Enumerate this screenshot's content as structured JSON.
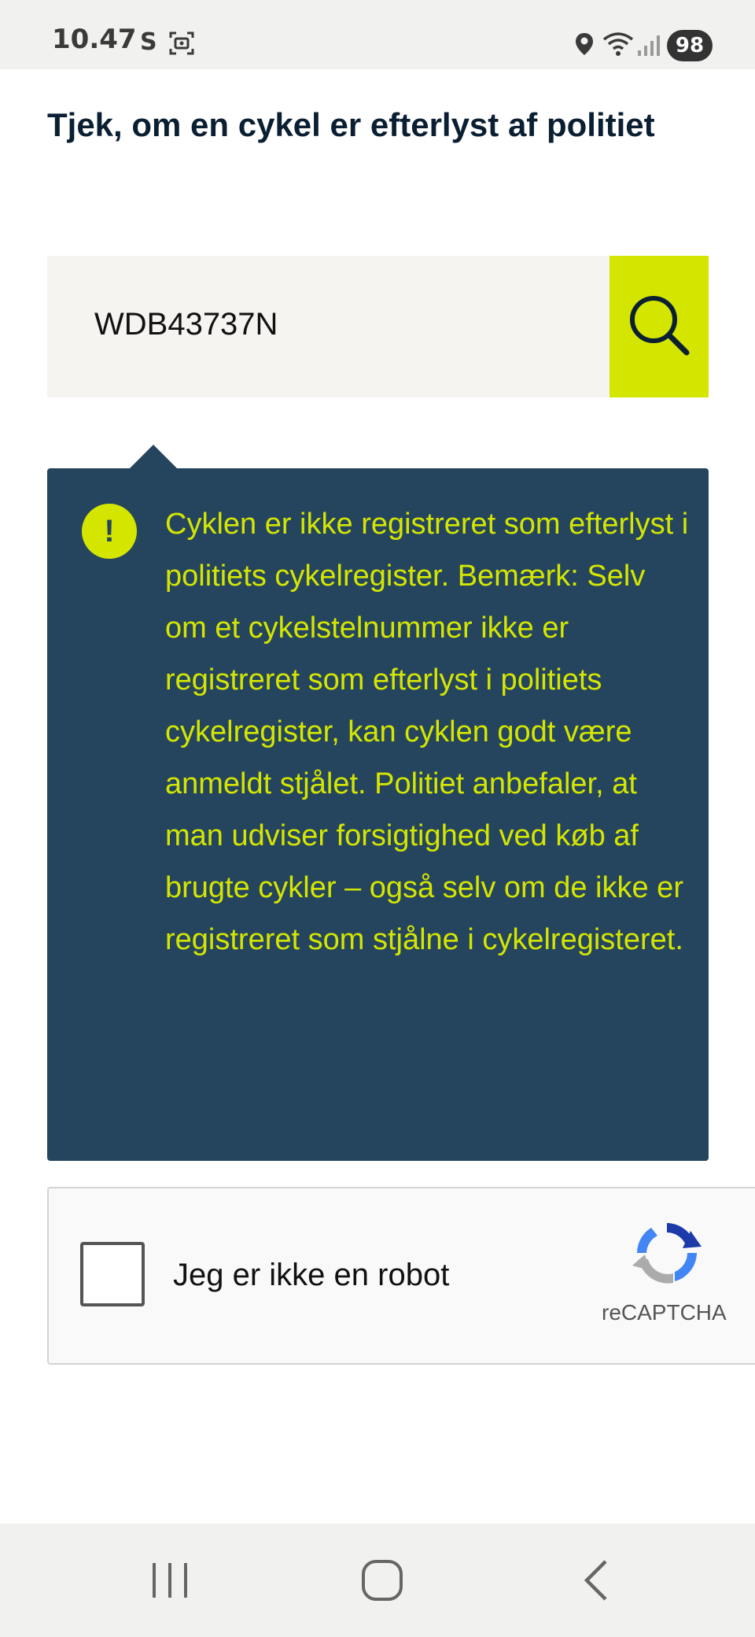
{
  "status_bar": {
    "time": "10.47",
    "app_indicator": "S",
    "battery": "98",
    "icons": [
      "screenshot-icon",
      "location-icon",
      "wifi-icon",
      "signal-icon"
    ]
  },
  "page": {
    "title": "Tjek, om en cykel er efterlyst af politiet"
  },
  "search": {
    "value": "WDB43737N",
    "button_icon": "search-icon"
  },
  "result": {
    "icon": "alert-icon",
    "icon_glyph": "!",
    "message": "Cyklen er ikke registreret som efterlyst i politiets cykelregister. Bemærk: Selv om et cykelstelnummer ikke er registreret som efterlyst i politiets cykelregister, kan cyklen godt være anmeldt stjålet. Politiet anbefaler, at man udviser forsigtighed ved køb af brugte cykler – også selv om de ikke er registreret som stjålne i cykelregisteret."
  },
  "recaptcha": {
    "label": "Jeg er ikke en robot",
    "brand": "reCAPTCHA"
  },
  "nav_bar": {
    "icons": [
      "recent-apps-icon",
      "home-icon",
      "back-icon"
    ]
  },
  "colors": {
    "accent": "#d4e600",
    "panel": "#25455f",
    "title": "#0b1f33",
    "search_bg": "#f6f4f0"
  }
}
